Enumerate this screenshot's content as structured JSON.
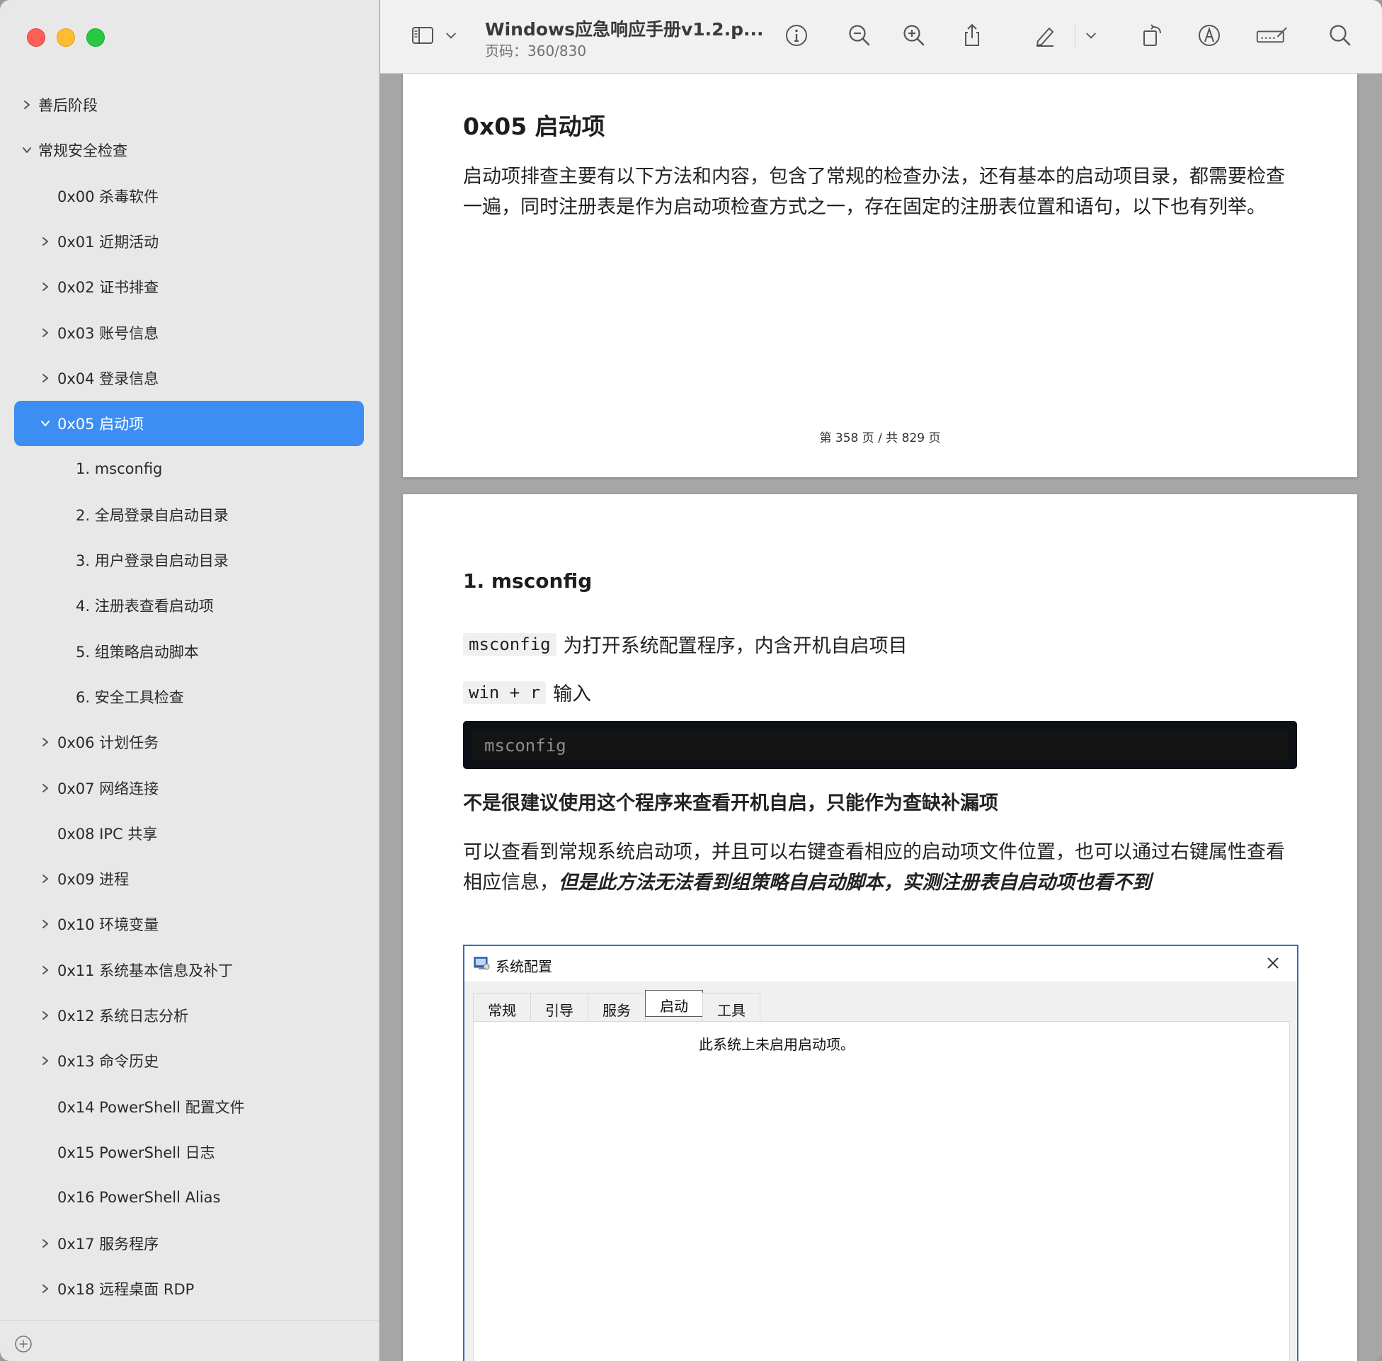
{
  "window": {
    "doc_title": "Windows应急响应手册v1.2.p...",
    "page_indicator": "页码：360/830"
  },
  "sidebar": {
    "items": [
      {
        "label": "善后阶段",
        "level": 0,
        "chevron": "right",
        "selected": false
      },
      {
        "label": "常规安全检查",
        "level": 0,
        "chevron": "down",
        "selected": false
      },
      {
        "label": "0x00 杀毒软件",
        "level": 1,
        "chevron": "none",
        "selected": false
      },
      {
        "label": "0x01 近期活动",
        "level": 1,
        "chevron": "right",
        "selected": false
      },
      {
        "label": "0x02 证书排查",
        "level": 1,
        "chevron": "right",
        "selected": false
      },
      {
        "label": "0x03 账号信息",
        "level": 1,
        "chevron": "right",
        "selected": false
      },
      {
        "label": "0x04 登录信息",
        "level": 1,
        "chevron": "right",
        "selected": false
      },
      {
        "label": "0x05 启动项",
        "level": 1,
        "chevron": "down",
        "selected": true
      },
      {
        "label": "1. msconfig",
        "level": 2,
        "chevron": "none",
        "selected": false
      },
      {
        "label": "2. 全局登录自启动目录",
        "level": 2,
        "chevron": "none",
        "selected": false
      },
      {
        "label": "3. 用户登录自启动目录",
        "level": 2,
        "chevron": "none",
        "selected": false
      },
      {
        "label": "4. 注册表查看启动项",
        "level": 2,
        "chevron": "none",
        "selected": false
      },
      {
        "label": "5. 组策略启动脚本",
        "level": 2,
        "chevron": "none",
        "selected": false
      },
      {
        "label": "6. 安全工具检查",
        "level": 2,
        "chevron": "none",
        "selected": false
      },
      {
        "label": "0x06 计划任务",
        "level": 1,
        "chevron": "right",
        "selected": false
      },
      {
        "label": "0x07 网络连接",
        "level": 1,
        "chevron": "right",
        "selected": false
      },
      {
        "label": "0x08 IPC 共享",
        "level": 1,
        "chevron": "none",
        "selected": false
      },
      {
        "label": "0x09 进程",
        "level": 1,
        "chevron": "right",
        "selected": false
      },
      {
        "label": "0x10 环境变量",
        "level": 1,
        "chevron": "right",
        "selected": false
      },
      {
        "label": "0x11 系统基本信息及补丁",
        "level": 1,
        "chevron": "right",
        "selected": false
      },
      {
        "label": "0x12 系统日志分析",
        "level": 1,
        "chevron": "right",
        "selected": false
      },
      {
        "label": "0x13 命令历史",
        "level": 1,
        "chevron": "right",
        "selected": false
      },
      {
        "label": "0x14 PowerShell 配置文件",
        "level": 1,
        "chevron": "none",
        "selected": false
      },
      {
        "label": "0x15 PowerShell 日志",
        "level": 1,
        "chevron": "none",
        "selected": false
      },
      {
        "label": "0x16 PowerShell Alias",
        "level": 1,
        "chevron": "none",
        "selected": false
      },
      {
        "label": "0x17 服务程序",
        "level": 1,
        "chevron": "right",
        "selected": false
      },
      {
        "label": "0x18 远程桌面 RDP",
        "level": 1,
        "chevron": "right",
        "selected": false
      }
    ]
  },
  "toolbar": {
    "icons": [
      "sidebar-toggle-icon",
      "chevron-down-icon",
      "info-icon",
      "zoom-out-icon",
      "zoom-in-icon",
      "share-icon",
      "highlight-pen-icon",
      "chevron-down-icon",
      "rotate-icon",
      "markup-icon",
      "form-fill-icon",
      "search-icon"
    ]
  },
  "page1": {
    "heading": "0x05 启动项",
    "paragraph": "启动项排查主要有以下方法和内容，包含了常规的检查办法，还有基本的启动项目录，都需要检查一遍，同时注册表是作为启动项检查方式之一，存在固定的注册表位置和语句，以下也有列举。",
    "footer": "第 358 页 / 共 829 页"
  },
  "page2": {
    "heading": "1. msconfig",
    "line1_code": "msconfig",
    "line1_text": "为打开系统配置程序，内含开机自启项目",
    "line2_code": "win + r",
    "line2_text": "输入",
    "codeblock": "msconfig",
    "bold_line": "不是很建议使用这个程序来查看开机自启，只能作为查缺补漏项",
    "para_normal": "可以查看到常规系统启动项，并且可以右键查看相应的启动项文件位置，也可以通过右键属性查看相应信息，",
    "para_emphasis": "但是此方法无法看到组策略自启动脚本，实测注册表自启动项也看不到",
    "screenshot": {
      "title": "系统配置",
      "tabs": [
        "常规",
        "引导",
        "服务",
        "启动",
        "工具"
      ],
      "active_tab": "启动",
      "message": "此系统上未启用启动项。"
    }
  },
  "colors": {
    "sidebar_bg": "#e9e8e8",
    "selection": "#3d8ef2",
    "toolbar_bg": "#f2f1f1",
    "canvas_bg": "#a6a6a6"
  }
}
